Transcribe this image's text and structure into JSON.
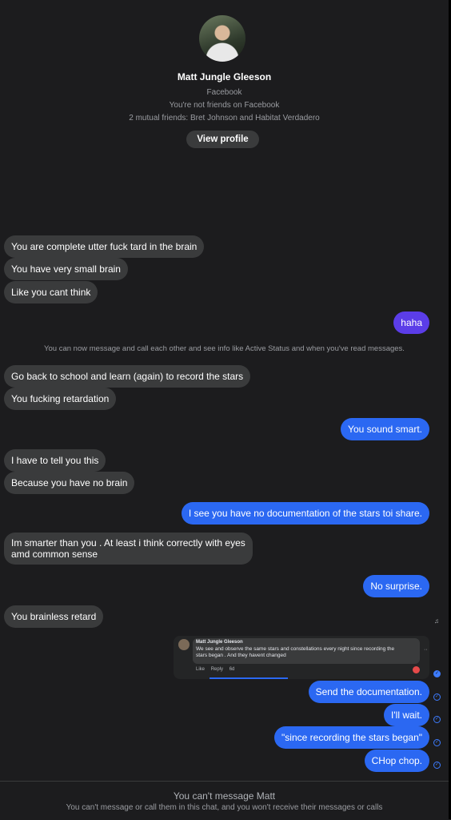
{
  "header": {
    "name": "Matt Jungle Gleeson",
    "platform": "Facebook",
    "friend_status": "You're not friends on Facebook",
    "mutual_friends": "2 mutual friends: Bret Johnson and Habitat Verdadero",
    "view_profile_label": "View profile"
  },
  "messages": {
    "m1": "You are complete utter fuck tard in the brain",
    "m2": "You have very small brain",
    "m3": "Like you cant think",
    "m4": "haha",
    "sys1": "You can now message and call each other and see info like Active Status and when you've read messages.",
    "m5": "Go back to school and learn (again) to record the stars",
    "m6": "You fucking retardation",
    "m7": "You sound smart.",
    "m8": "I have to tell you this",
    "m9": "Because you have no brain",
    "m10": "I see you have no documentation of the stars toi share.",
    "m11_line1": "Im smarter than you . At least i think correctly with eyes",
    "m11_line2": "amd common sense",
    "m12": "No surprise.",
    "m13": "You brainless retard",
    "m14": "Send the documentation.",
    "m15": "I'll wait.",
    "m16": "\"since recording the stars began\"",
    "m17": "CHop chop."
  },
  "shared_screenshot": {
    "author": "Matt Jungle Gleeson",
    "text": "We see and observe the same stars and constellations every night since recording the stars began . And they havent changed",
    "like": "Like",
    "reply": "Reply",
    "age": "6d"
  },
  "footer": {
    "title": "You can't message Matt",
    "subtitle": "You can't message or call them in this chat, and you won't receive their messages or calls"
  },
  "colors": {
    "background": "#1c1c1e",
    "incoming_bubble": "#3a3b3c",
    "outgoing_bubble": "#2b68f2",
    "outgoing_bubble_first": "#5b3de8"
  }
}
